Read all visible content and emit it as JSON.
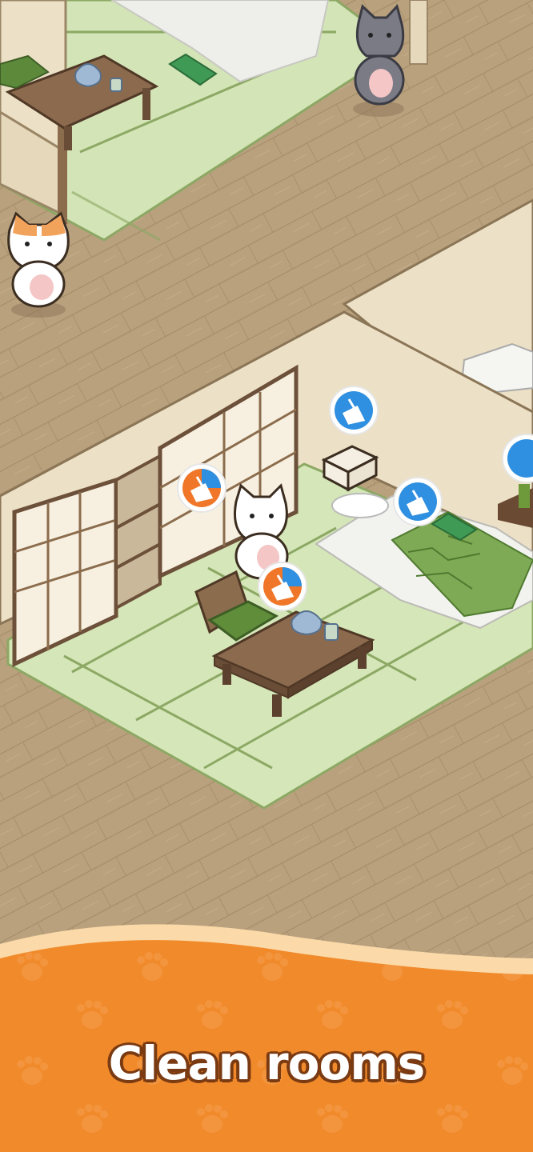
{
  "banner": {
    "caption": "Clean rooms"
  },
  "icons": {
    "cleaning_in_progress": "broom-orange-badge-icon",
    "cleaning_available": "broom-blue-badge-icon"
  },
  "colors": {
    "wood_floor": "#b9a17e",
    "tatami": "#d5e6b8",
    "tatami_border": "#8ca864",
    "wall": "#ece0c6",
    "banner_orange": "#f18a2b",
    "badge_blue": "#2f8fe0",
    "badge_orange": "#f0772a"
  }
}
